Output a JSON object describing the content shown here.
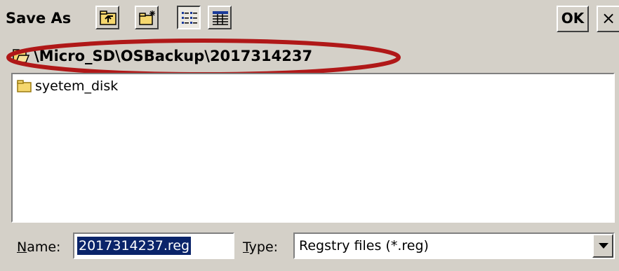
{
  "dialog": {
    "title": "Save As",
    "ok_label": "OK",
    "close_label": "×"
  },
  "toolbar": {
    "buttons": [
      {
        "icon": "up-folder-icon"
      },
      {
        "icon": "new-folder-icon"
      },
      {
        "icon": "list-view-icon",
        "pressed": true
      },
      {
        "icon": "details-view-icon"
      }
    ]
  },
  "path": {
    "current": "\\Micro_SD\\OSBackup\\2017314237",
    "icon": "open-folder-icon",
    "highlight_color": "#b01818"
  },
  "files": [
    {
      "name": "syetem_disk",
      "icon": "folder-icon"
    }
  ],
  "form": {
    "name_label_key": "N",
    "name_label_rest": "ame:",
    "name_value": "2017314237.reg",
    "type_label_key": "T",
    "type_label_rest": "ype:",
    "type_value": "Regstry files (*.reg)"
  },
  "colors": {
    "face": "#d4d0c8",
    "selection": "#0a246a",
    "folder": "#f5d76e"
  }
}
